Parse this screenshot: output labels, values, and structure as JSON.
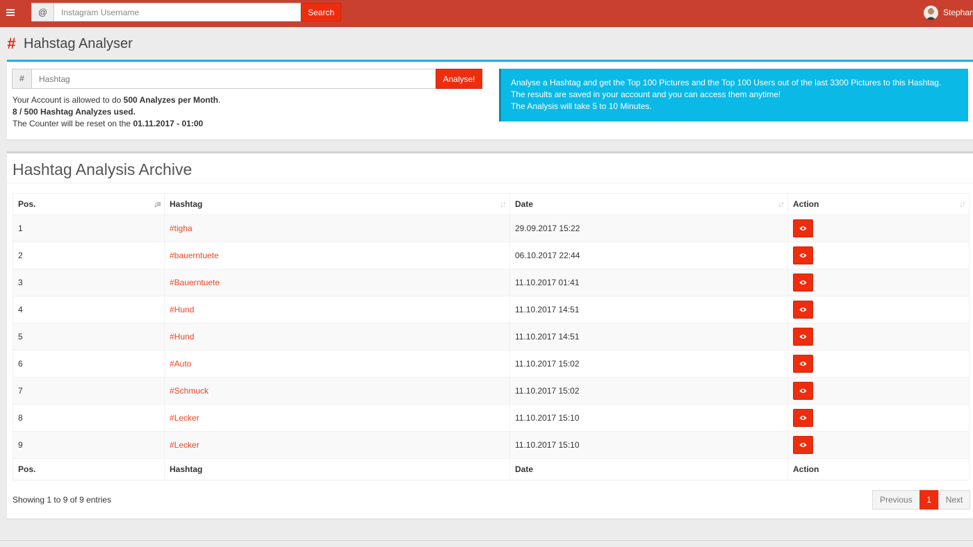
{
  "topbar": {
    "menu_icon": "hamburger-icon",
    "search_addon": "@",
    "search_placeholder": "Instagram Username",
    "search_label": "Search",
    "user_name": "Stephan"
  },
  "header": {
    "icon": "#",
    "title": "Hahstag Analyser"
  },
  "analyse": {
    "addon": "#",
    "placeholder": "Hashtag",
    "button_label": "Analyse!",
    "line1_prefix": "Your Account is allowed to do ",
    "line1_bold": "500 Analyzes per Month",
    "line1_suffix": ".",
    "line2": "8 / 500 Hashtag Analyzes used.",
    "line3_prefix": "The Counter will be reset on the ",
    "line3_bold": "01.11.2017 - 01:00"
  },
  "callout": {
    "line1": "Analyse a Hashtag and get the Top 100 Pictures and the Top 100 Users out of the last 3300 Pictures to this Hashtag.",
    "line2": "The results are saved in your account and you can access them anytime!",
    "line3": "The Analysis will take 5 to 10 Minutes."
  },
  "archive": {
    "title": "Hashtag Analysis Archive",
    "columns": [
      "Pos.",
      "Hashtag",
      "Date",
      "Action"
    ],
    "rows": [
      {
        "pos": "1",
        "hashtag": "#tigha",
        "date": "29.09.2017 15:22"
      },
      {
        "pos": "2",
        "hashtag": "#bauerntuete",
        "date": "06.10.2017 22:44"
      },
      {
        "pos": "3",
        "hashtag": "#Bauerntuete",
        "date": "11.10.2017 01:41"
      },
      {
        "pos": "4",
        "hashtag": "#Hund",
        "date": "11.10.2017 14:51"
      },
      {
        "pos": "5",
        "hashtag": "#Hund",
        "date": "11.10.2017 14:51"
      },
      {
        "pos": "6",
        "hashtag": "#Auto",
        "date": "11.10.2017 15:02"
      },
      {
        "pos": "7",
        "hashtag": "#Schmuck",
        "date": "11.10.2017 15:02"
      },
      {
        "pos": "8",
        "hashtag": "#Lecker",
        "date": "11.10.2017 15:10"
      },
      {
        "pos": "9",
        "hashtag": "#Lecker",
        "date": "11.10.2017 15:10"
      }
    ],
    "action_icon": "eye-icon",
    "entries_info": "Showing 1 to 9 of 9 entries",
    "pager": {
      "previous": "Previous",
      "current": "1",
      "next": "Next"
    }
  },
  "colors": {
    "topbar": "#c9402f",
    "accent": "#ee2d0e",
    "callout": "#0ab9e6",
    "panel_border": "#1fb0dd"
  }
}
